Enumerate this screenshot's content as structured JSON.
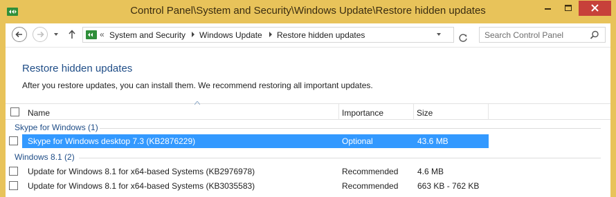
{
  "window": {
    "title": "Control Panel\\System and Security\\Windows Update\\Restore hidden updates",
    "buttons": {
      "minimize": "minimize",
      "maximize": "maximize",
      "close": "close"
    }
  },
  "address": {
    "overflow": "«",
    "crumbs": [
      "System and Security",
      "Windows Update",
      "Restore hidden updates"
    ]
  },
  "search": {
    "placeholder": "Search Control Panel"
  },
  "page": {
    "title": "Restore hidden updates",
    "description": "After you restore updates, you can install them. We recommend restoring all important updates."
  },
  "table": {
    "columns": [
      "Name",
      "Importance",
      "Size"
    ],
    "groups": [
      {
        "label": "Skype for Windows (1)",
        "rows": [
          {
            "name": "Skype for Windows desktop 7.3 (KB2876229)",
            "importance": "Optional",
            "size": "43.6 MB",
            "selected": true
          }
        ]
      },
      {
        "label": "Windows 8.1 (2)",
        "rows": [
          {
            "name": "Update for Windows 8.1 for x64-based Systems (KB2976978)",
            "importance": "Recommended",
            "size": "4.6 MB",
            "selected": false
          },
          {
            "name": "Update for Windows 8.1 for x64-based Systems (KB3035583)",
            "importance": "Recommended",
            "size": "663 KB - 762 KB",
            "selected": false
          }
        ]
      }
    ]
  },
  "colors": {
    "titlebar": "#e8c35a",
    "accent_title": "#1f4d87",
    "selection": "#3399ff",
    "close_button": "#c7413a"
  },
  "icons": [
    "control-panel-icon",
    "close-icon",
    "minimize-icon",
    "maximize-icon",
    "back-arrow-icon",
    "forward-arrow-icon",
    "recent-dropdown-icon",
    "up-arrow-icon",
    "refresh-icon",
    "search-icon",
    "sort-up-icon"
  ]
}
